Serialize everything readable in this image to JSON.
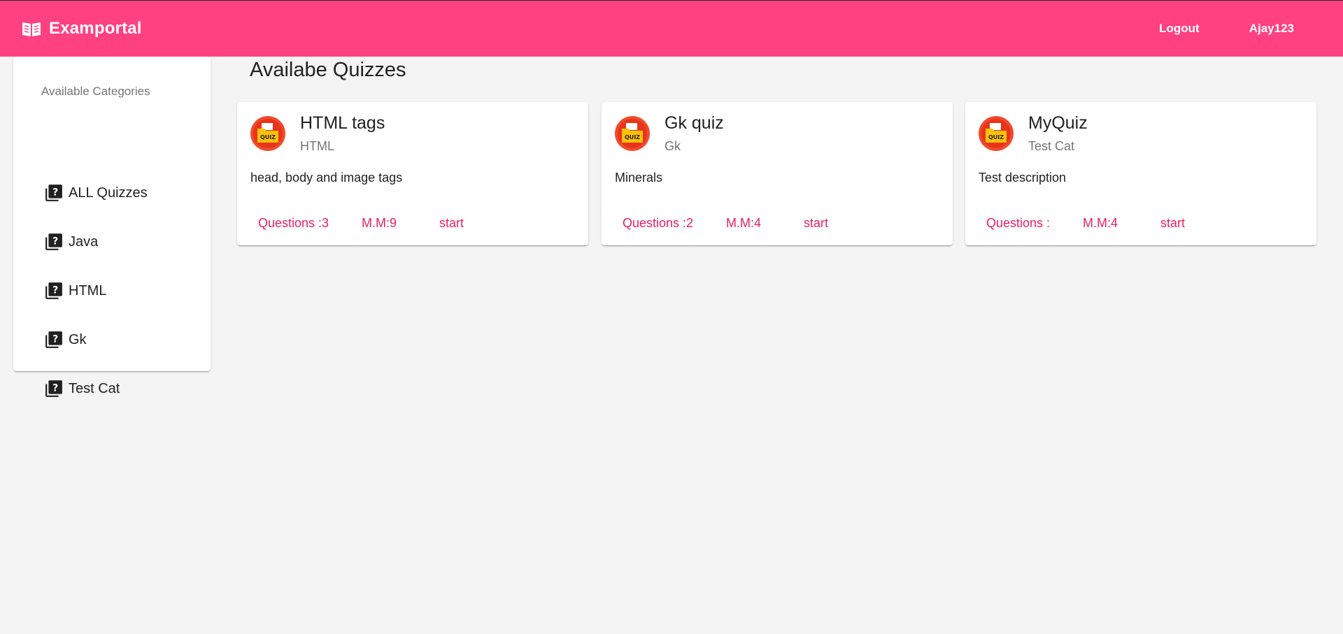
{
  "header": {
    "brand": "Examportal",
    "logout": "Logout",
    "username": "Ajay123",
    "background": "#ff4081"
  },
  "sidebar": {
    "heading": "Available Categories",
    "items": [
      {
        "label": "ALL Quizzes",
        "icon": "quiz-icon"
      },
      {
        "label": "Java",
        "icon": "quiz-icon"
      },
      {
        "label": "HTML",
        "icon": "quiz-icon"
      },
      {
        "label": "Gk",
        "icon": "quiz-icon"
      },
      {
        "label": "Test Cat",
        "icon": "quiz-icon"
      }
    ]
  },
  "main": {
    "title": "Availabe Quizzes",
    "quizzes": [
      {
        "title": "HTML tags",
        "category": "HTML",
        "description": "head, body and image tags",
        "questions": "Questions :3",
        "max_marks": "M.M:9",
        "start": "start"
      },
      {
        "title": "Gk quiz",
        "category": "Gk",
        "description": "Minerals",
        "questions": "Questions :2",
        "max_marks": "M.M:4",
        "start": "start"
      },
      {
        "title": "MyQuiz",
        "category": "Test Cat",
        "description": "Test description",
        "questions": "Questions :",
        "max_marks": "M.M:4",
        "start": "start"
      }
    ]
  },
  "colors": {
    "accent": "#e91e63",
    "primary": "#ff4081"
  }
}
